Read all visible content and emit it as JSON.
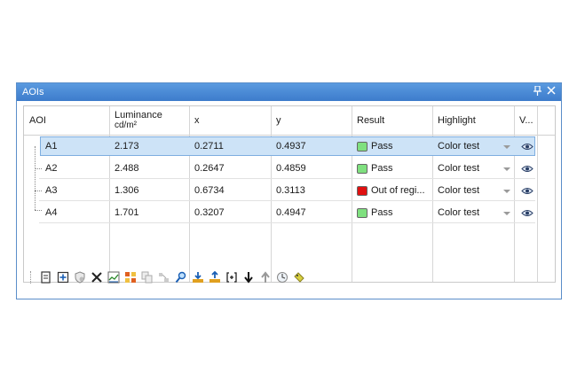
{
  "panel": {
    "title": "AOIs"
  },
  "columns": {
    "aoi": "AOI",
    "luminance": "Luminance",
    "luminance_unit": "cd/m²",
    "x": "x",
    "y": "y",
    "result": "Result",
    "highlight": "Highlight",
    "visible": "V..."
  },
  "rows": [
    {
      "aoi": "A1",
      "luminance": "2.173",
      "x": "0.2711",
      "y": "0.4937",
      "result": "Pass",
      "result_color": "#7fe07f",
      "highlight": "Color test"
    },
    {
      "aoi": "A2",
      "luminance": "2.488",
      "x": "0.2647",
      "y": "0.4859",
      "result": "Pass",
      "result_color": "#7fe07f",
      "highlight": "Color test"
    },
    {
      "aoi": "A3",
      "luminance": "1.306",
      "x": "0.6734",
      "y": "0.3113",
      "result": "Out of regi...",
      "result_color": "#e01010",
      "highlight": "Color test"
    },
    {
      "aoi": "A4",
      "luminance": "1.701",
      "x": "0.3207",
      "y": "0.4947",
      "result": "Pass",
      "result_color": "#7fe07f",
      "highlight": "Color test"
    }
  ],
  "selected_row": "A1",
  "toolbar": {
    "icons": [
      "new-aoi-icon",
      "add-aoi-icon",
      "shield-icon",
      "delete-icon",
      "chart-icon",
      "grid-icon",
      "copy-icon",
      "arrange-icon",
      "magnify-icon",
      "download-icon",
      "upload-icon",
      "bracket-icon",
      "move-down-icon",
      "move-up-icon",
      "clock-icon",
      "tag-icon"
    ]
  },
  "colors": {
    "title_bar": "#3d7ccb",
    "selection": "#cde3f7",
    "pass": "#7fe07f",
    "fail": "#e01010"
  }
}
